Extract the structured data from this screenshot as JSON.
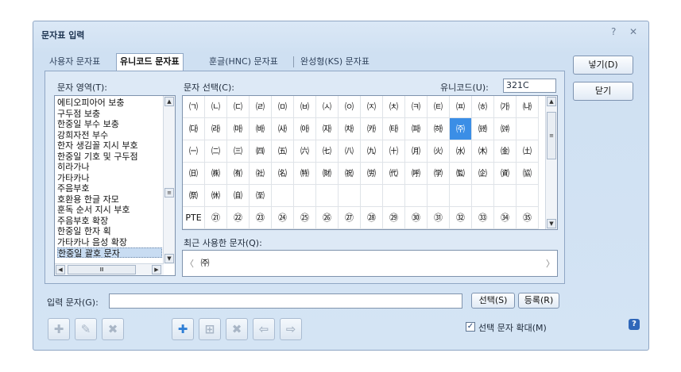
{
  "window": {
    "title": "문자표 입력",
    "help_glyph": "?",
    "close_glyph": "✕"
  },
  "tabs": [
    "사용자 문자표",
    "유니코드 문자표",
    "훈글(HNC) 문자표",
    "완성형(KS) 문자표"
  ],
  "active_tab": "유니코드 문자표",
  "area_label": "문자 영역(T):",
  "char_select_label": "문자 선택(C):",
  "unicode_label": "유니코드(U):",
  "unicode_value": "321C",
  "areas": [
    "에티오피아어 보충",
    "구두점 보충",
    "한중일 부수 보충",
    "강희자전 부수",
    "한자 생김꼴 지시 부호",
    "한중일 기호 및 구두점",
    "히라가나",
    "가타카나",
    "주음부호",
    "호환용 한글 자모",
    "훈독 순서 지시 부호",
    "주음부호 확장",
    "한중일 한자 획",
    "가타카나 음성 확장",
    "한중일 괄호 문자"
  ],
  "selected_area": "한중일 괄호 문자",
  "chars": [
    [
      "㈀",
      "㈁",
      "㈂",
      "㈃",
      "㈄",
      "㈅",
      "㈆",
      "㈇",
      "㈈",
      "㈉",
      "㈊",
      "㈋",
      "㈌",
      "㈍",
      "㈎",
      "㈏"
    ],
    [
      "㈐",
      "㈑",
      "㈒",
      "㈓",
      "㈔",
      "㈕",
      "㈖",
      "㈗",
      "㈘",
      "㈙",
      "㈚",
      "㈛",
      "㈜",
      "㈝",
      "㈞",
      ""
    ],
    [
      "㈠",
      "㈡",
      "㈢",
      "㈣",
      "㈤",
      "㈥",
      "㈦",
      "㈧",
      "㈨",
      "㈩",
      "㈪",
      "㈫",
      "㈬",
      "㈭",
      "㈮",
      "㈯"
    ],
    [
      "㈰",
      "㈱",
      "㈲",
      "㈳",
      "㈴",
      "㈵",
      "㈶",
      "㈷",
      "㈸",
      "㈹",
      "㈺",
      "㈻",
      "㈼",
      "㈽",
      "㈾",
      "㈿"
    ],
    [
      "㉀",
      "㉁",
      "㉂",
      "㉃",
      "",
      "",
      "",
      "",
      "",
      "",
      "",
      "",
      "",
      "",
      "",
      ""
    ],
    [
      "PTE",
      "㉑",
      "㉒",
      "㉓",
      "㉔",
      "㉕",
      "㉖",
      "㉗",
      "㉘",
      "㉙",
      "㉚",
      "㉛",
      "㉜",
      "㉝",
      "㉞",
      "㉟"
    ]
  ],
  "selected_char": "㈜",
  "recent_label": "최근 사용한 문자(Q):",
  "recent_chars": [
    "㈜"
  ],
  "input_label": "입력 문자(G):",
  "input_value": "",
  "buttons": {
    "insert": "넣기(D)",
    "close": "닫기",
    "select": "선택(S)",
    "register": "등록(R)"
  },
  "enlarge_label": "선택 문자 확대(M)",
  "enlarge_checked": true,
  "check_glyph": "✓",
  "toolbar_icons": [
    "add-all-icon",
    "edit-icon",
    "delete-all-icon",
    "add-icon",
    "insert-icon",
    "delete-icon",
    "move-left-icon",
    "move-right-icon"
  ],
  "toolbar_glyphs": {
    "add": "✚",
    "insert": "⊞",
    "delete": "✖",
    "left": "⇦",
    "right": "⇨",
    "multi_add": "✚",
    "multi_edit": "✎",
    "multi_del": "✖"
  },
  "colors": {
    "accent": "#3b8ee6",
    "panel": "#dde9f6",
    "border": "#8fa6c4"
  }
}
